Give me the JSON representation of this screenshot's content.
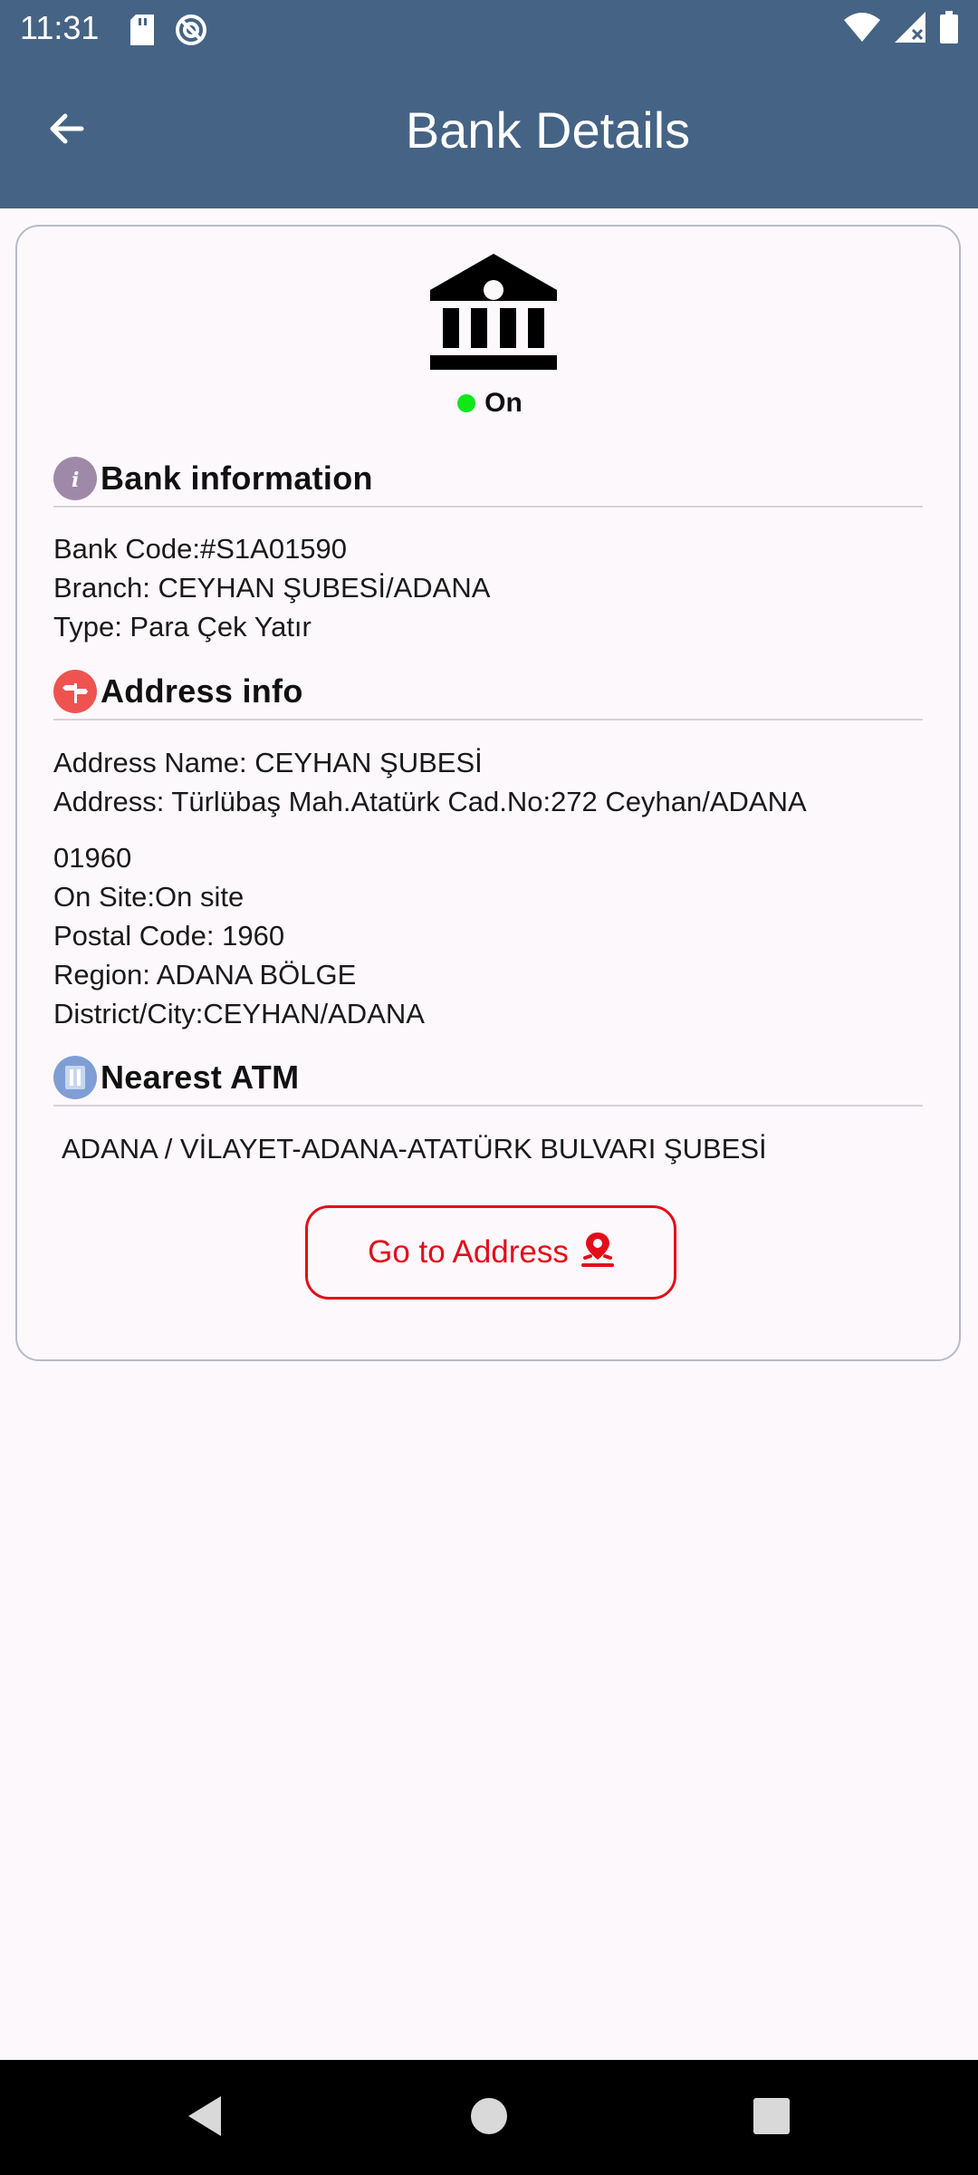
{
  "status_bar": {
    "time": "11:31"
  },
  "app_bar": {
    "title": "Bank Details"
  },
  "bank": {
    "status": "On"
  },
  "bank_information": {
    "title": "Bank information",
    "lines": [
      "Bank Code:#S1A01590",
      "Branch: CEYHAN ŞUBESİ/ADANA",
      "Type: Para Çek Yatır"
    ]
  },
  "address_info": {
    "title": "Address info",
    "lines": [
      "Address Name: CEYHAN ŞUBESİ",
      "Address: Türlübaş Mah.Atatürk Cad.No:272 Ceyhan/ADANA",
      "01960",
      "On Site:On site",
      "Postal Code: 1960",
      "Region: ADANA BÖLGE",
      "District/City:CEYHAN/ADANA"
    ]
  },
  "nearest_atm": {
    "title": "Nearest ATM",
    "value": "ADANA / VİLAYET-ADANA-ATATÜRK BULVARI ŞUBESİ"
  },
  "actions": {
    "go_to_address": "Go to Address"
  },
  "colors": {
    "app_bar": "#456385",
    "status_on": "#12e51a",
    "accent_red": "#e30d1a"
  }
}
